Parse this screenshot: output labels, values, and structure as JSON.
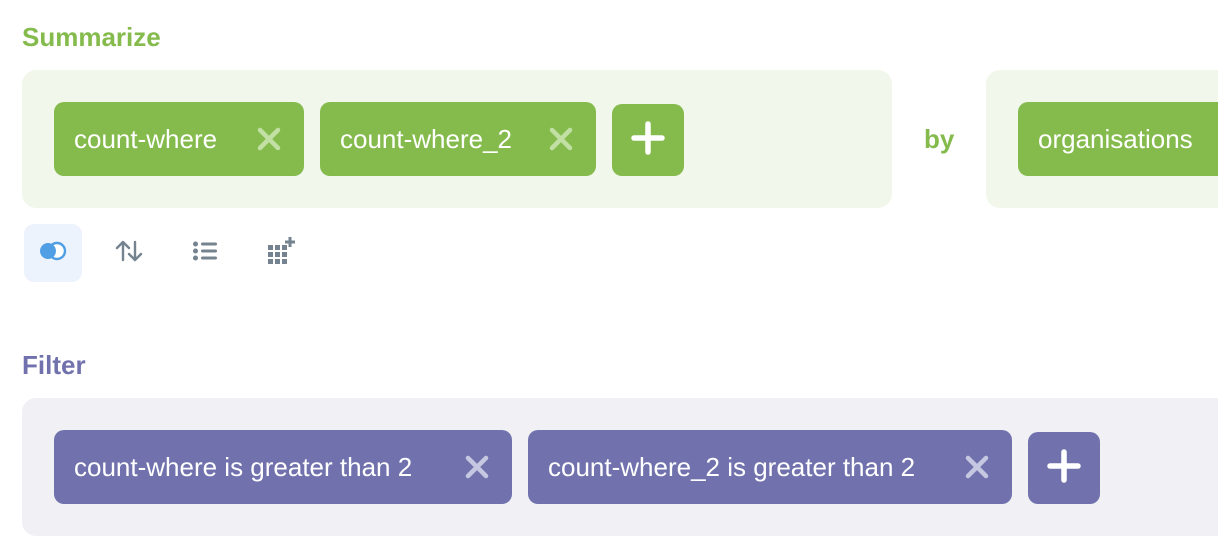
{
  "summarize": {
    "title": "Summarize",
    "metrics": [
      {
        "label": "count-where"
      },
      {
        "label": "count-where_2"
      }
    ],
    "by_label": "by",
    "group_by": [
      {
        "label": "organisations"
      }
    ]
  },
  "filter": {
    "title": "Filter",
    "conditions": [
      {
        "label": "count-where is greater than 2"
      },
      {
        "label": "count-where_2 is greater than 2"
      }
    ]
  },
  "toolbar": {
    "icons": [
      "join-icon",
      "sort-icon",
      "list-icon",
      "custom-column-icon"
    ]
  },
  "colors": {
    "summarize_accent": "#84bb4c",
    "summarize_bg": "#f2f7eb",
    "filter_accent": "#7172ad",
    "filter_bg": "#f0f0f5",
    "remove_icon": "#c3e0a4",
    "remove_icon_filter": "#c6c7e0"
  }
}
